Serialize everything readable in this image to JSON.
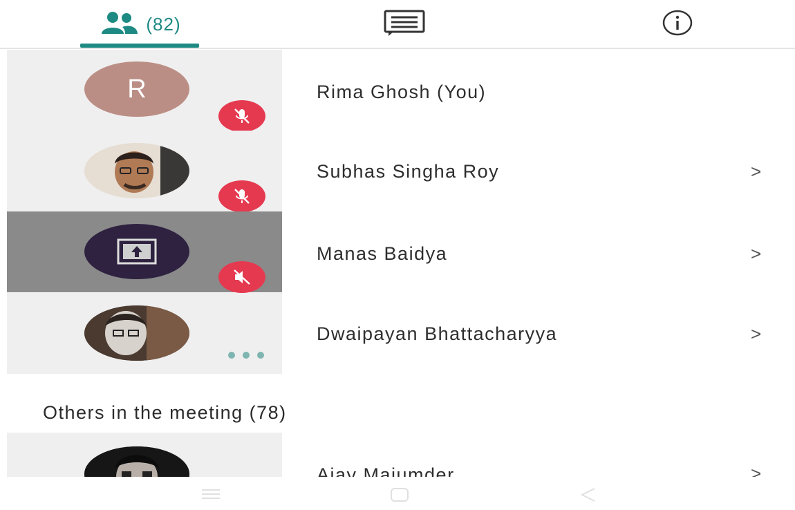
{
  "tabs": {
    "people": {
      "icon": "people-icon",
      "count": "(82)"
    },
    "chat": {
      "icon": "chat-icon"
    },
    "info": {
      "icon": "info-icon"
    }
  },
  "participants": [
    {
      "name": "Rima Ghosh (You)",
      "avatar_initial": "R",
      "avatar_type": "initial",
      "status_icon": "mic-off-icon",
      "has_chevron": false
    },
    {
      "name": "Subhas Singha Roy",
      "avatar_type": "photo",
      "status_icon": "mic-off-icon",
      "has_chevron": true,
      "chevron": ">"
    },
    {
      "name": "Manas Baidya",
      "avatar_type": "screen-share",
      "status_icon": "volume-off-icon",
      "has_chevron": true,
      "chevron": ">",
      "selected": true
    },
    {
      "name": "Dwaipayan Bhattacharyya",
      "avatar_type": "photo",
      "status_icon": "more-dots-icon",
      "has_chevron": true,
      "chevron": ">"
    }
  ],
  "others_section": {
    "title": "Others in the meeting (78)"
  },
  "others": [
    {
      "name": "Ajay Majumder",
      "avatar_type": "photo",
      "chevron": ">"
    }
  ],
  "colors": {
    "accent": "#1e8a84",
    "mute_red": "#e53950",
    "selected_bg": "#8a8a8a"
  }
}
